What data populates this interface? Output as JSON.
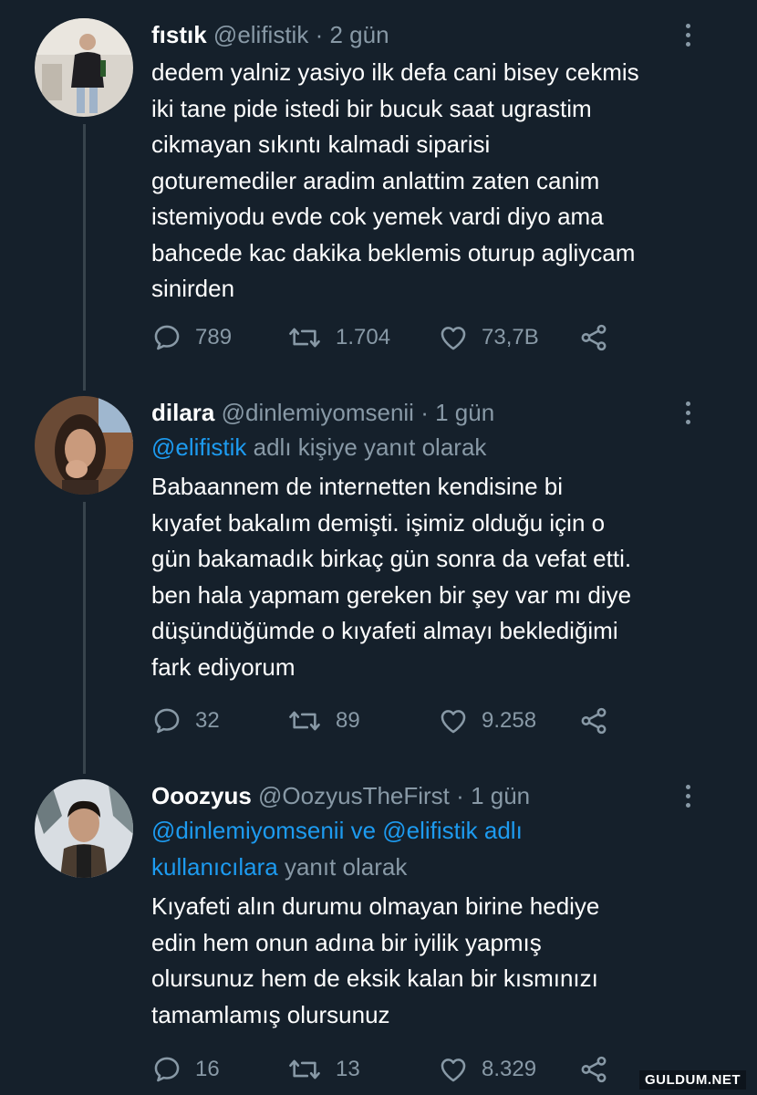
{
  "colors": {
    "background": "#15202b",
    "text": "#ffffff",
    "muted": "#8899a6",
    "link": "#1d9bf0",
    "thread_line": "#38444d"
  },
  "tweets": [
    {
      "name": "fıstık",
      "handle": "@elifistik",
      "separator": "·",
      "time": "2 gün",
      "body": "dedem yalniz yasiyo ilk defa cani bisey cekmis\niki tane pide istedi bir bucuk saat ugrastim\ncikmayan sıkıntı kalmadi siparisi\ngoturemediler aradim anlattim zaten canim\nistemiyodu evde cok yemek vardi diyo ama\nbahcede kac dakika beklemis oturup agliycam\nsinirden",
      "replies": "789",
      "retweets": "1.704",
      "likes": "73,7B"
    },
    {
      "name": "dilara",
      "handle": "@dinlemiyomsenii",
      "separator": "·",
      "time": "1 gün",
      "reply_mention": "@elifistik",
      "reply_suffix": " adlı kişiye yanıt olarak",
      "body": "Babaannem de internetten kendisine bi\nkıyafet bakalım demişti. işimiz olduğu için o\ngün bakamadık birkaç gün sonra da vefat etti.\nben hala yapmam gereken bir şey var mı diye\ndüşündüğümde o kıyafeti almayı beklediğimi\nfark ediyorum",
      "replies": "32",
      "retweets": "89",
      "likes": "9.258"
    },
    {
      "name": "Ooozyus",
      "handle": "@OozyusTheFirst",
      "separator": "·",
      "time": "1 gün",
      "reply_line1": "@dinlemiyomsenii ve @elifistik adlı",
      "reply_mention2": "kullanıcılara",
      "reply_suffix": " yanıt olarak",
      "body": "Kıyafeti alın durumu olmayan birine hediye\nedin hem onun adına bir iyilik yapmış\nolursunuz hem de eksik kalan bir kısmınızı\ntamamlamış olursunuz",
      "replies": "16",
      "retweets": "13",
      "likes": "8.329"
    }
  ],
  "icons": {
    "reply": "reply-icon",
    "retweet": "retweet-icon",
    "like": "heart-icon",
    "share": "share-icon",
    "more": "more-icon"
  },
  "watermark": "GULDUM.NET"
}
